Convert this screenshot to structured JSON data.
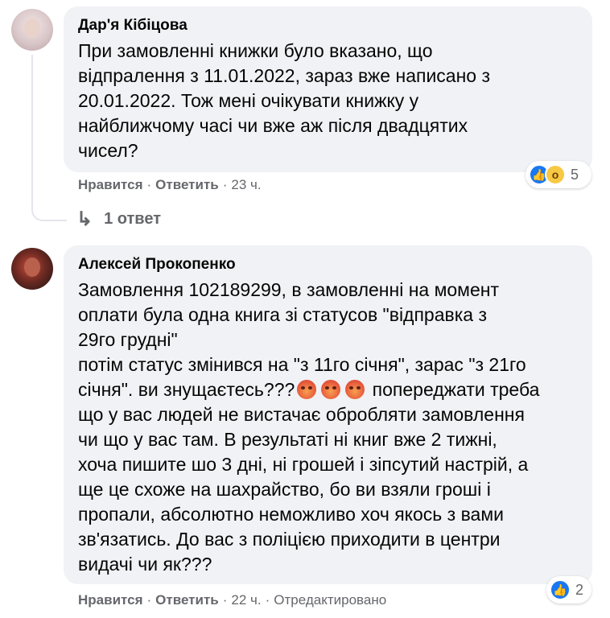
{
  "comments": [
    {
      "author": "Дар'я Кібіцова",
      "text": "При замовленні книжки було вказано, що\nвідпралення з 11.01.2022, зараз вже написано з\n20.01.2022. Тож мені очікувати книжку у\nнайближчому часі чи вже аж після двадцятих\nчисел?",
      "reaction_count": "5",
      "reactions": [
        "like-icon",
        "wow-icon"
      ],
      "actions": {
        "like": "Нравится",
        "reply": "Ответить",
        "time": "23 ч."
      },
      "replies_link": "1 ответ"
    },
    {
      "author": "Алексей Прокопенко",
      "text_before_emoji": "Замовлення 102189299, в замовленні на момент\nоплати була одна книга зі статусов \"відправка з\n29го грудні\"\nпотім статус змінився на \"з 11го січня\", зарас \"з 21го\nсічня\". ви знущаєтесь???",
      "text_after_emoji": " попереджати треба\nщо у вас людей не вистачає обробляти замовлення\nчи що у вас там. В результаті ні книг вже 2 тижні,\nхоча пишите шо 3 дні, ні грошей і зіпсутий настрій, а\nще це схоже на шахрайство, бо ви взяли гроші і\nпропали, абсолютно неможливо хоч якось з вами\nзв'язатись. До вас з поліцією приходити в центри\nвидачі чи як???",
      "emoji": [
        "angry-face-icon",
        "angry-face-icon",
        "angry-face-icon"
      ],
      "reaction_count": "2",
      "reactions": [
        "like-icon"
      ],
      "actions": {
        "like": "Нравится",
        "reply": "Ответить",
        "time": "22 ч.",
        "edited": "Отредактировано"
      }
    }
  ],
  "colors": {
    "bubble": "#f0f2f5",
    "secondary_text": "#65676b",
    "like_blue": "#1877f2"
  }
}
